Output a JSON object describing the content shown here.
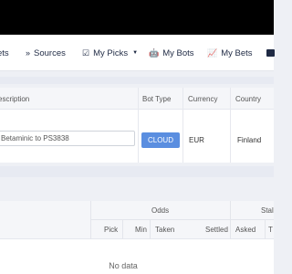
{
  "nav": {
    "items": [
      {
        "label": "ets",
        "icon": ""
      },
      {
        "label": "Sources",
        "icon": "»"
      },
      {
        "label": "My Picks",
        "icon": "☑",
        "caret": "▼"
      },
      {
        "label": "My Bots",
        "icon": "🤖"
      },
      {
        "label": "My Bets",
        "icon": "📈"
      }
    ]
  },
  "bot_table": {
    "headers": {
      "description": "escription",
      "bot_type": "Bot Type",
      "currency": "Currency",
      "country": "Country"
    },
    "row": {
      "description": "Betaminic to PS3838",
      "bot_type": "CLOUD",
      "currency": "EUR",
      "country": "Finland"
    }
  },
  "bets_table": {
    "group_headers": {
      "odds": "Odds",
      "stake": "Stal"
    },
    "columns": {
      "pick": "Pick",
      "min": "Min",
      "taken": "Taken",
      "settled": "Settled",
      "asked": "Asked",
      "t": "T"
    },
    "empty_message": "No data"
  },
  "colors": {
    "accent": "#5a8ee0",
    "nav_text": "#1f2a44",
    "topbar": "#000000"
  }
}
